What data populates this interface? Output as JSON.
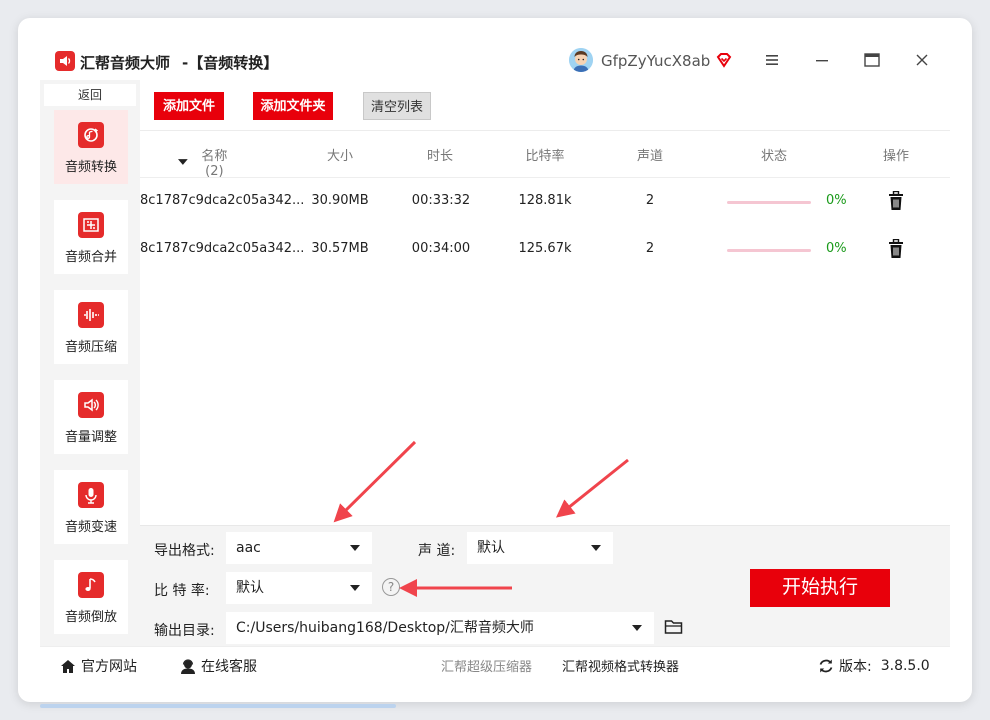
{
  "app": {
    "title": "汇帮音频大师",
    "subtitle": "-【音频转换】",
    "username": "GfpZyYucX8ab"
  },
  "sidebar": {
    "back_label": "返回",
    "items": [
      {
        "label": "音频转换",
        "icon": "audio-convert-icon"
      },
      {
        "label": "音频合并",
        "icon": "audio-merge-icon"
      },
      {
        "label": "音频压缩",
        "icon": "audio-compress-icon"
      },
      {
        "label": "音量调整",
        "icon": "volume-adjust-icon"
      },
      {
        "label": "音频变速",
        "icon": "audio-speed-icon"
      },
      {
        "label": "音频倒放",
        "icon": "audio-reverse-icon"
      }
    ]
  },
  "toolbar": {
    "add_file": "添加文件",
    "add_folder": "添加文件夹",
    "clear_list": "清空列表"
  },
  "table": {
    "headers": {
      "name": "名称 (2)",
      "size": "大小",
      "duration": "时长",
      "bitrate": "比特率",
      "channels": "声道",
      "status": "状态",
      "action": "操作"
    },
    "rows": [
      {
        "name": "8c1787c9dca2c05a342...",
        "size": "30.90MB",
        "duration": "00:33:32",
        "bitrate": "128.81k",
        "channels": "2",
        "progress": 0,
        "progress_text": "0%"
      },
      {
        "name": "8c1787c9dca2c05a342...",
        "size": "30.57MB",
        "duration": "00:34:00",
        "bitrate": "125.67k",
        "channels": "2",
        "progress": 0,
        "progress_text": "0%"
      }
    ]
  },
  "settings": {
    "format_label": "导出格式:",
    "format_value": "aac",
    "channel_label": "声 道:",
    "channel_value": "默认",
    "bitrate_label": "比 特 率:",
    "bitrate_value": "默认",
    "help_symbol": "?",
    "output_label": "输出目录:",
    "output_value": "C:/Users/huibang168/Desktop/汇帮音频大师",
    "start_label": "开始执行"
  },
  "footer": {
    "website": "官方网站",
    "support": "在线客服",
    "compressor": "汇帮超级压缩器",
    "video_converter": "汇帮视频格式转换器",
    "version_label": "版本:",
    "version": "3.8.5.0"
  },
  "colors": {
    "accent_red": "#e8000b",
    "progress_track": "#f5c6d2",
    "progress_text": "#1a9a1a"
  }
}
